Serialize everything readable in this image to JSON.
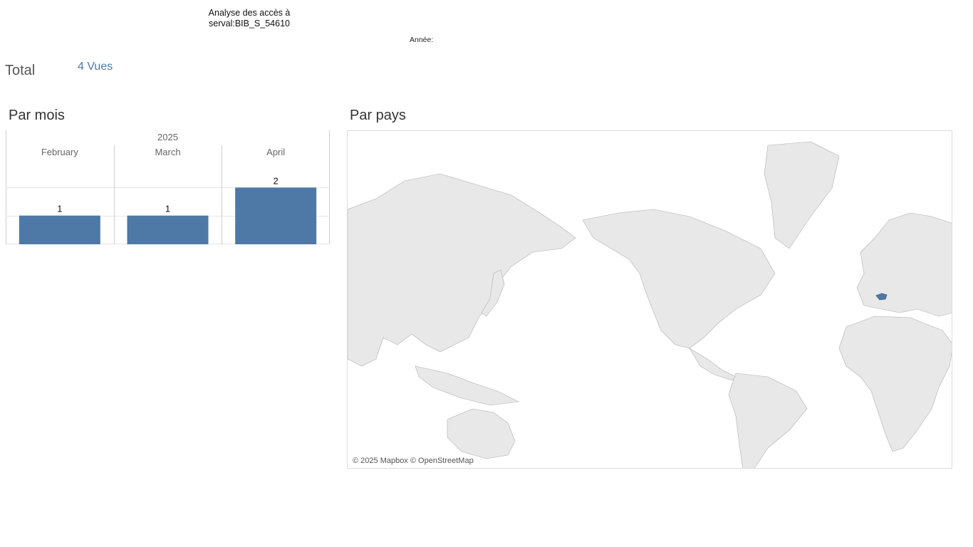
{
  "header": {
    "title_line1": "Analyse des accès à",
    "title_line2": "serval:BIB_S_54610",
    "year_filter_label": "Année:"
  },
  "summary": {
    "total_label": "Total",
    "total_value": "4 Vues"
  },
  "sections": {
    "by_month_title": "Par mois",
    "by_country_title": "Par pays"
  },
  "chart_data": {
    "type": "bar",
    "year_label": "2025",
    "categories": [
      "February",
      "March",
      "April"
    ],
    "values": [
      1,
      1,
      2
    ],
    "ylim": [
      0,
      3
    ],
    "grid": true,
    "bar_color": "#4e79a7"
  },
  "map": {
    "attribution": "© 2025 Mapbox © OpenStreetMap",
    "highlighted_country": "Switzerland",
    "highlight_color": "#4e79a7",
    "land_color": "#e8e8e8",
    "border_color": "#b0b0b0"
  }
}
